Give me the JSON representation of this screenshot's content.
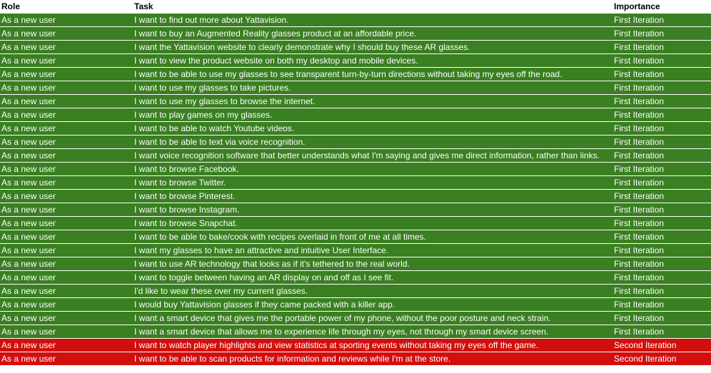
{
  "headers": {
    "role": "Role",
    "task": "Task",
    "importance": "Importance"
  },
  "colors": {
    "first_iteration": "#3a7f21",
    "second_iteration": "#d10f0d"
  },
  "rows": [
    {
      "role": "As a new user",
      "task": "I want to find out more about Yattavision.",
      "importance": "First Iteration"
    },
    {
      "role": "As a new user",
      "task": "I want to buy an Augmented Reality glasses product at an affordable price.",
      "importance": "First Iteration"
    },
    {
      "role": "As a new user",
      "task": "I want the Yattavision website to clearly demonstrate why I should buy these AR glasses.",
      "importance": "First Iteration"
    },
    {
      "role": "As a new user",
      "task": "I want to view the product website on both my desktop and mobile devices.",
      "importance": "First Iteration"
    },
    {
      "role": "As a new user",
      "task": "I want to be able to use my glasses to see transparent turn-by-turn directions without taking my eyes off the road.",
      "importance": "First Iteration"
    },
    {
      "role": "As a new user",
      "task": "I want to use my glasses to take pictures.",
      "importance": "First Iteration"
    },
    {
      "role": "As a new user",
      "task": "I want to use my glasses to browse the internet.",
      "importance": "First Iteration"
    },
    {
      "role": "As a new user",
      "task": "I want to play games on my glasses.",
      "importance": "First Iteration"
    },
    {
      "role": "As a new user",
      "task": "I want to be able to watch Youtube videos.",
      "importance": "First Iteration"
    },
    {
      "role": "As a new user",
      "task": "I want to be able to text via voice recognition.",
      "importance": "First Iteration"
    },
    {
      "role": "As a new user",
      "task": "I want voice recognition software that better understands what I'm saying and gives me direct information, rather than links.",
      "importance": "First Iteration"
    },
    {
      "role": "As a new user",
      "task": "I want to browse Facebook.",
      "importance": "First Iteration"
    },
    {
      "role": "As a new user",
      "task": "I want to browse Twitter.",
      "importance": "First Iteration"
    },
    {
      "role": "As a new user",
      "task": "I want to browse Pinterest.",
      "importance": "First Iteration"
    },
    {
      "role": "As a new user",
      "task": "I want to browse Instagram.",
      "importance": "First Iteration"
    },
    {
      "role": "As a new user",
      "task": "I want to browse Snapchat.",
      "importance": "First Iteration"
    },
    {
      "role": "As a new user",
      "task": "I want to be able to bake/cook with recipes overlaid in front of me at all times.",
      "importance": "First Iteration"
    },
    {
      "role": "As a new user",
      "task": "I want my glasses to have an attractive and intuitive User Interface.",
      "importance": "First Iteration"
    },
    {
      "role": "As a new user",
      "task": "I want to use AR technology that looks as if it's tethered to the real world.",
      "importance": "First Iteration"
    },
    {
      "role": "As a new user",
      "task": "I want to toggle between having an AR display on and off as I see fit.",
      "importance": "First Iteration"
    },
    {
      "role": "As a new user",
      "task": "I'd like to wear these over my current glasses.",
      "importance": "First Iteration"
    },
    {
      "role": "As a new user",
      "task": "I would buy Yattavision glasses if they came packed with a killer app.",
      "importance": "First Iteration"
    },
    {
      "role": "As a new user",
      "task": "I want a smart device that gives me the portable power of my phone, without the poor posture and neck strain.",
      "importance": "First Iteration"
    },
    {
      "role": "As a new user",
      "task": "I want a smart device that allows me to experience life through my eyes, not through my smart device screen.",
      "importance": "First Iteration"
    },
    {
      "role": "As a new user",
      "task": "I want to watch player highlights and view statistics at sporting events without taking my eyes off the game.",
      "importance": "Second Iteration"
    },
    {
      "role": "As a new user",
      "task": "I want to be able to scan products for information and reviews while I'm at the store.",
      "importance": "Second Iteration"
    }
  ]
}
